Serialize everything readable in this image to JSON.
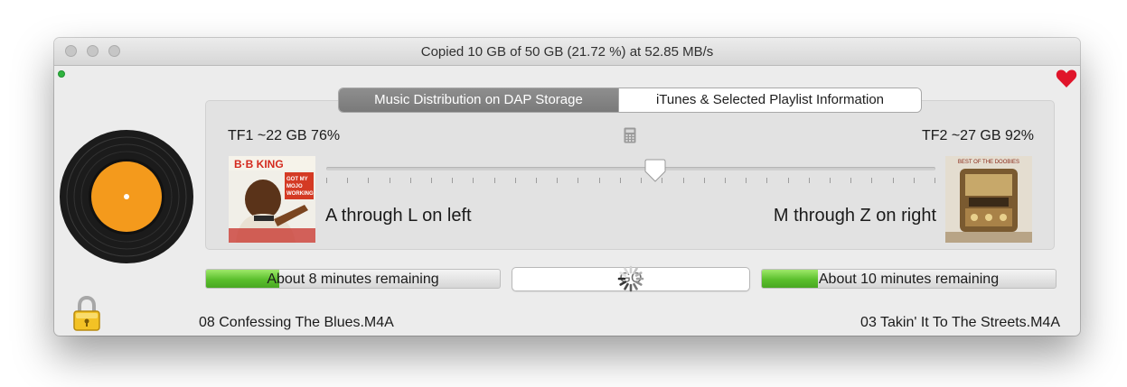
{
  "window": {
    "title": "Copied 10 GB of 50 GB (21.72 %) at 52.85 MB/s"
  },
  "tabs": [
    {
      "label": "Music Distribution on DAP Storage",
      "active": true
    },
    {
      "label": "iTunes & Selected Playlist Information",
      "active": false
    }
  ],
  "cards": {
    "left": {
      "label": "TF1 ~22 GB 76%",
      "range": "A through L on left"
    },
    "right": {
      "label": "TF2 ~27 GB 92%",
      "range": "M through Z on right"
    }
  },
  "slider": {
    "value_fraction": 0.54,
    "tick_count": 30
  },
  "albums": {
    "left": {
      "artist_text": "B·B KING",
      "subtitle_lines": [
        "GOT MY",
        "MOJO",
        "WORKING"
      ]
    },
    "right": {
      "title_text": "BEST OF THE DOOBIES"
    }
  },
  "progress": {
    "left": {
      "label": "About 8 minutes remaining",
      "fraction": 0.25
    },
    "right": {
      "label": "About 10 minutes remaining",
      "fraction": 0.19
    }
  },
  "go_button": {
    "label": "GO"
  },
  "files": {
    "left": "08 Confessing The Blues.M4A",
    "right": "03 Takin' It To The Streets.M4A"
  },
  "icons": {
    "status": "green-status-dot-icon",
    "favorite": "heart-icon",
    "record": "vinyl-record-icon",
    "lock": "padlock-icon",
    "calculator": "calculator-icon",
    "spinner": "busy-spinner-icon"
  },
  "colors": {
    "progress_fill": "#5bbf2d",
    "heart": "#e0142a",
    "record_label": "#f49a1c",
    "status_dot": "#2fb43e",
    "active_tab": "#7f7f7f"
  }
}
